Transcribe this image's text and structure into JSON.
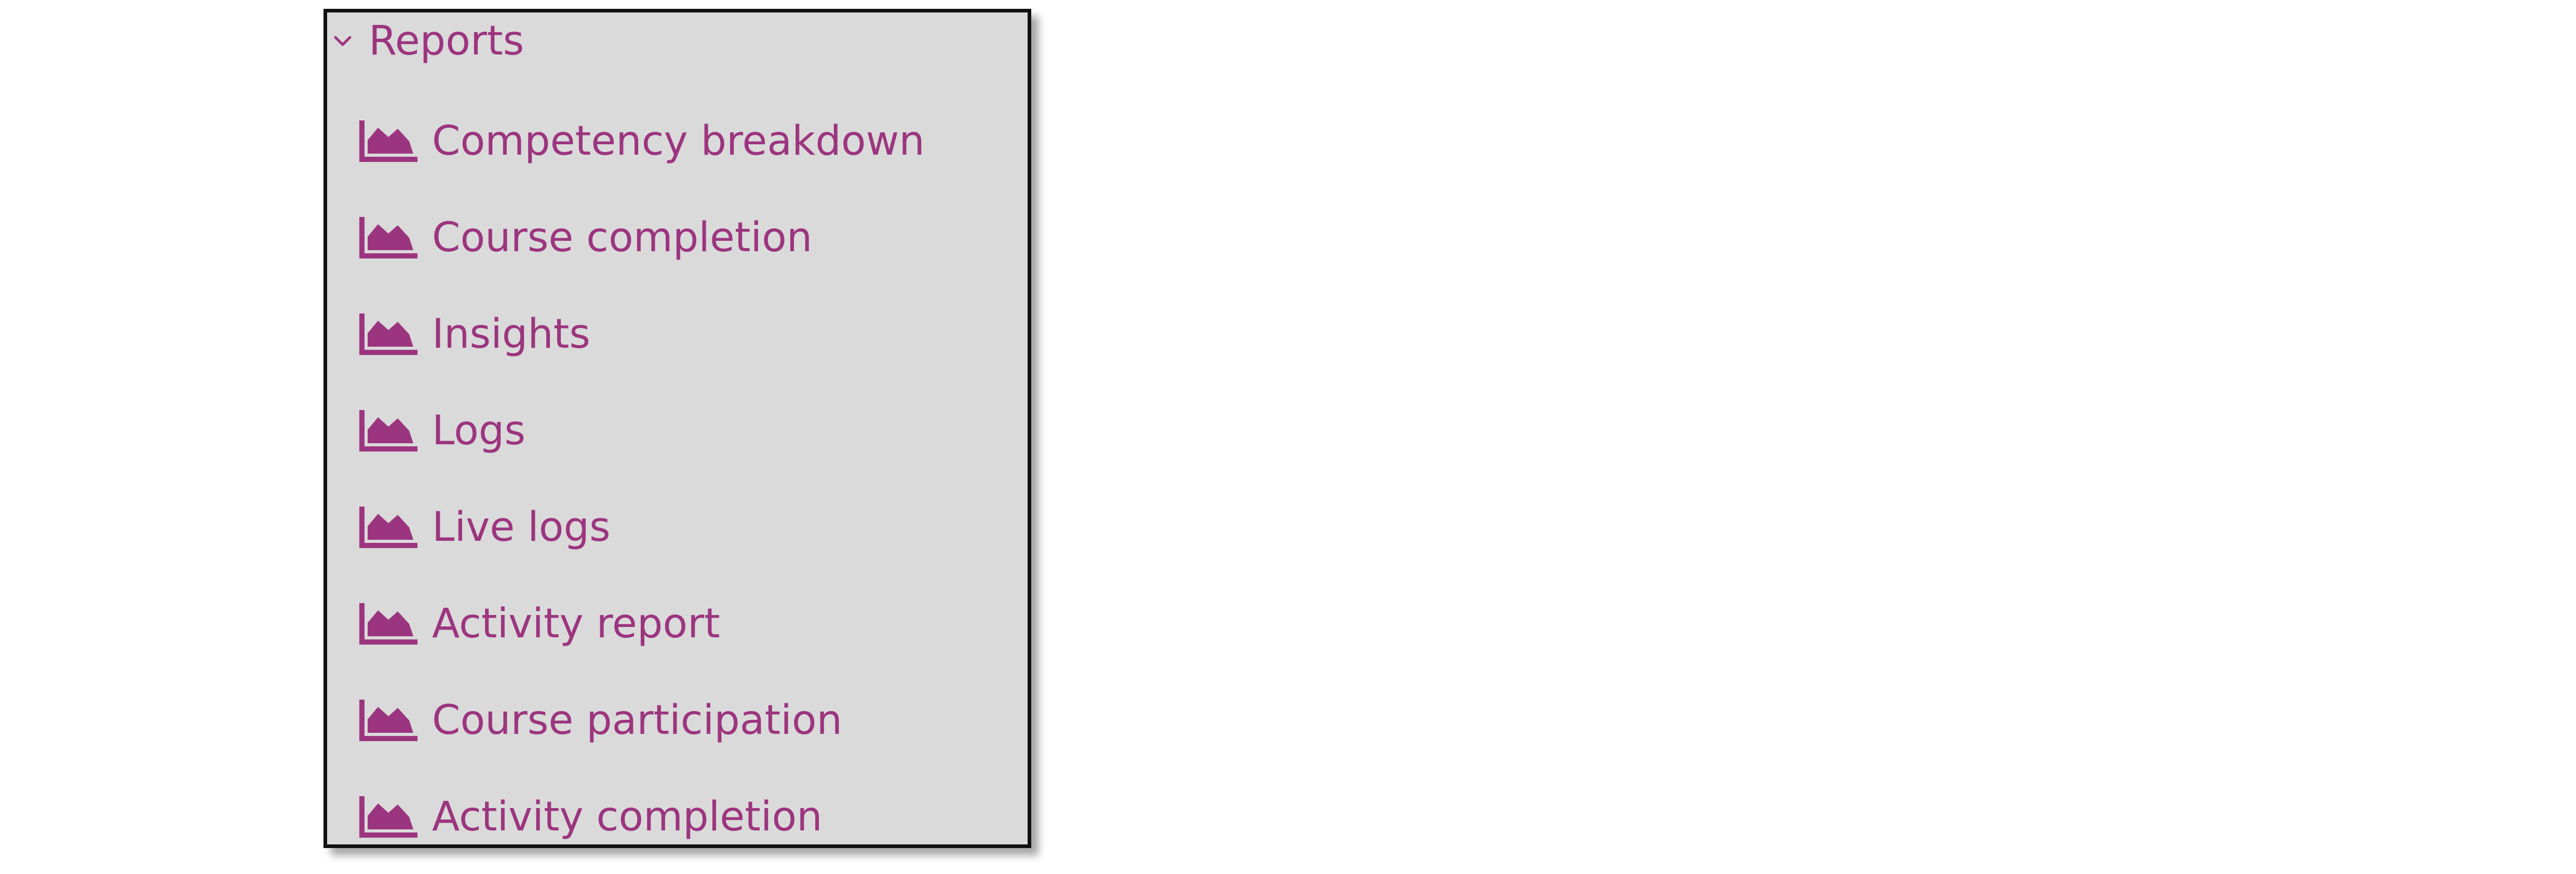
{
  "colors": {
    "link": "#9c357f",
    "panel_background": "#dadada",
    "panel_border": "#111111"
  },
  "reports": {
    "title": "Reports",
    "expanded": true,
    "toggle_icon": "chevron-down-icon",
    "item_icon": "area-chart-icon",
    "items": [
      {
        "label": "Competency breakdown"
      },
      {
        "label": "Course completion"
      },
      {
        "label": "Insights"
      },
      {
        "label": "Logs"
      },
      {
        "label": "Live logs"
      },
      {
        "label": "Activity report"
      },
      {
        "label": "Course participation"
      },
      {
        "label": "Activity completion"
      }
    ]
  }
}
